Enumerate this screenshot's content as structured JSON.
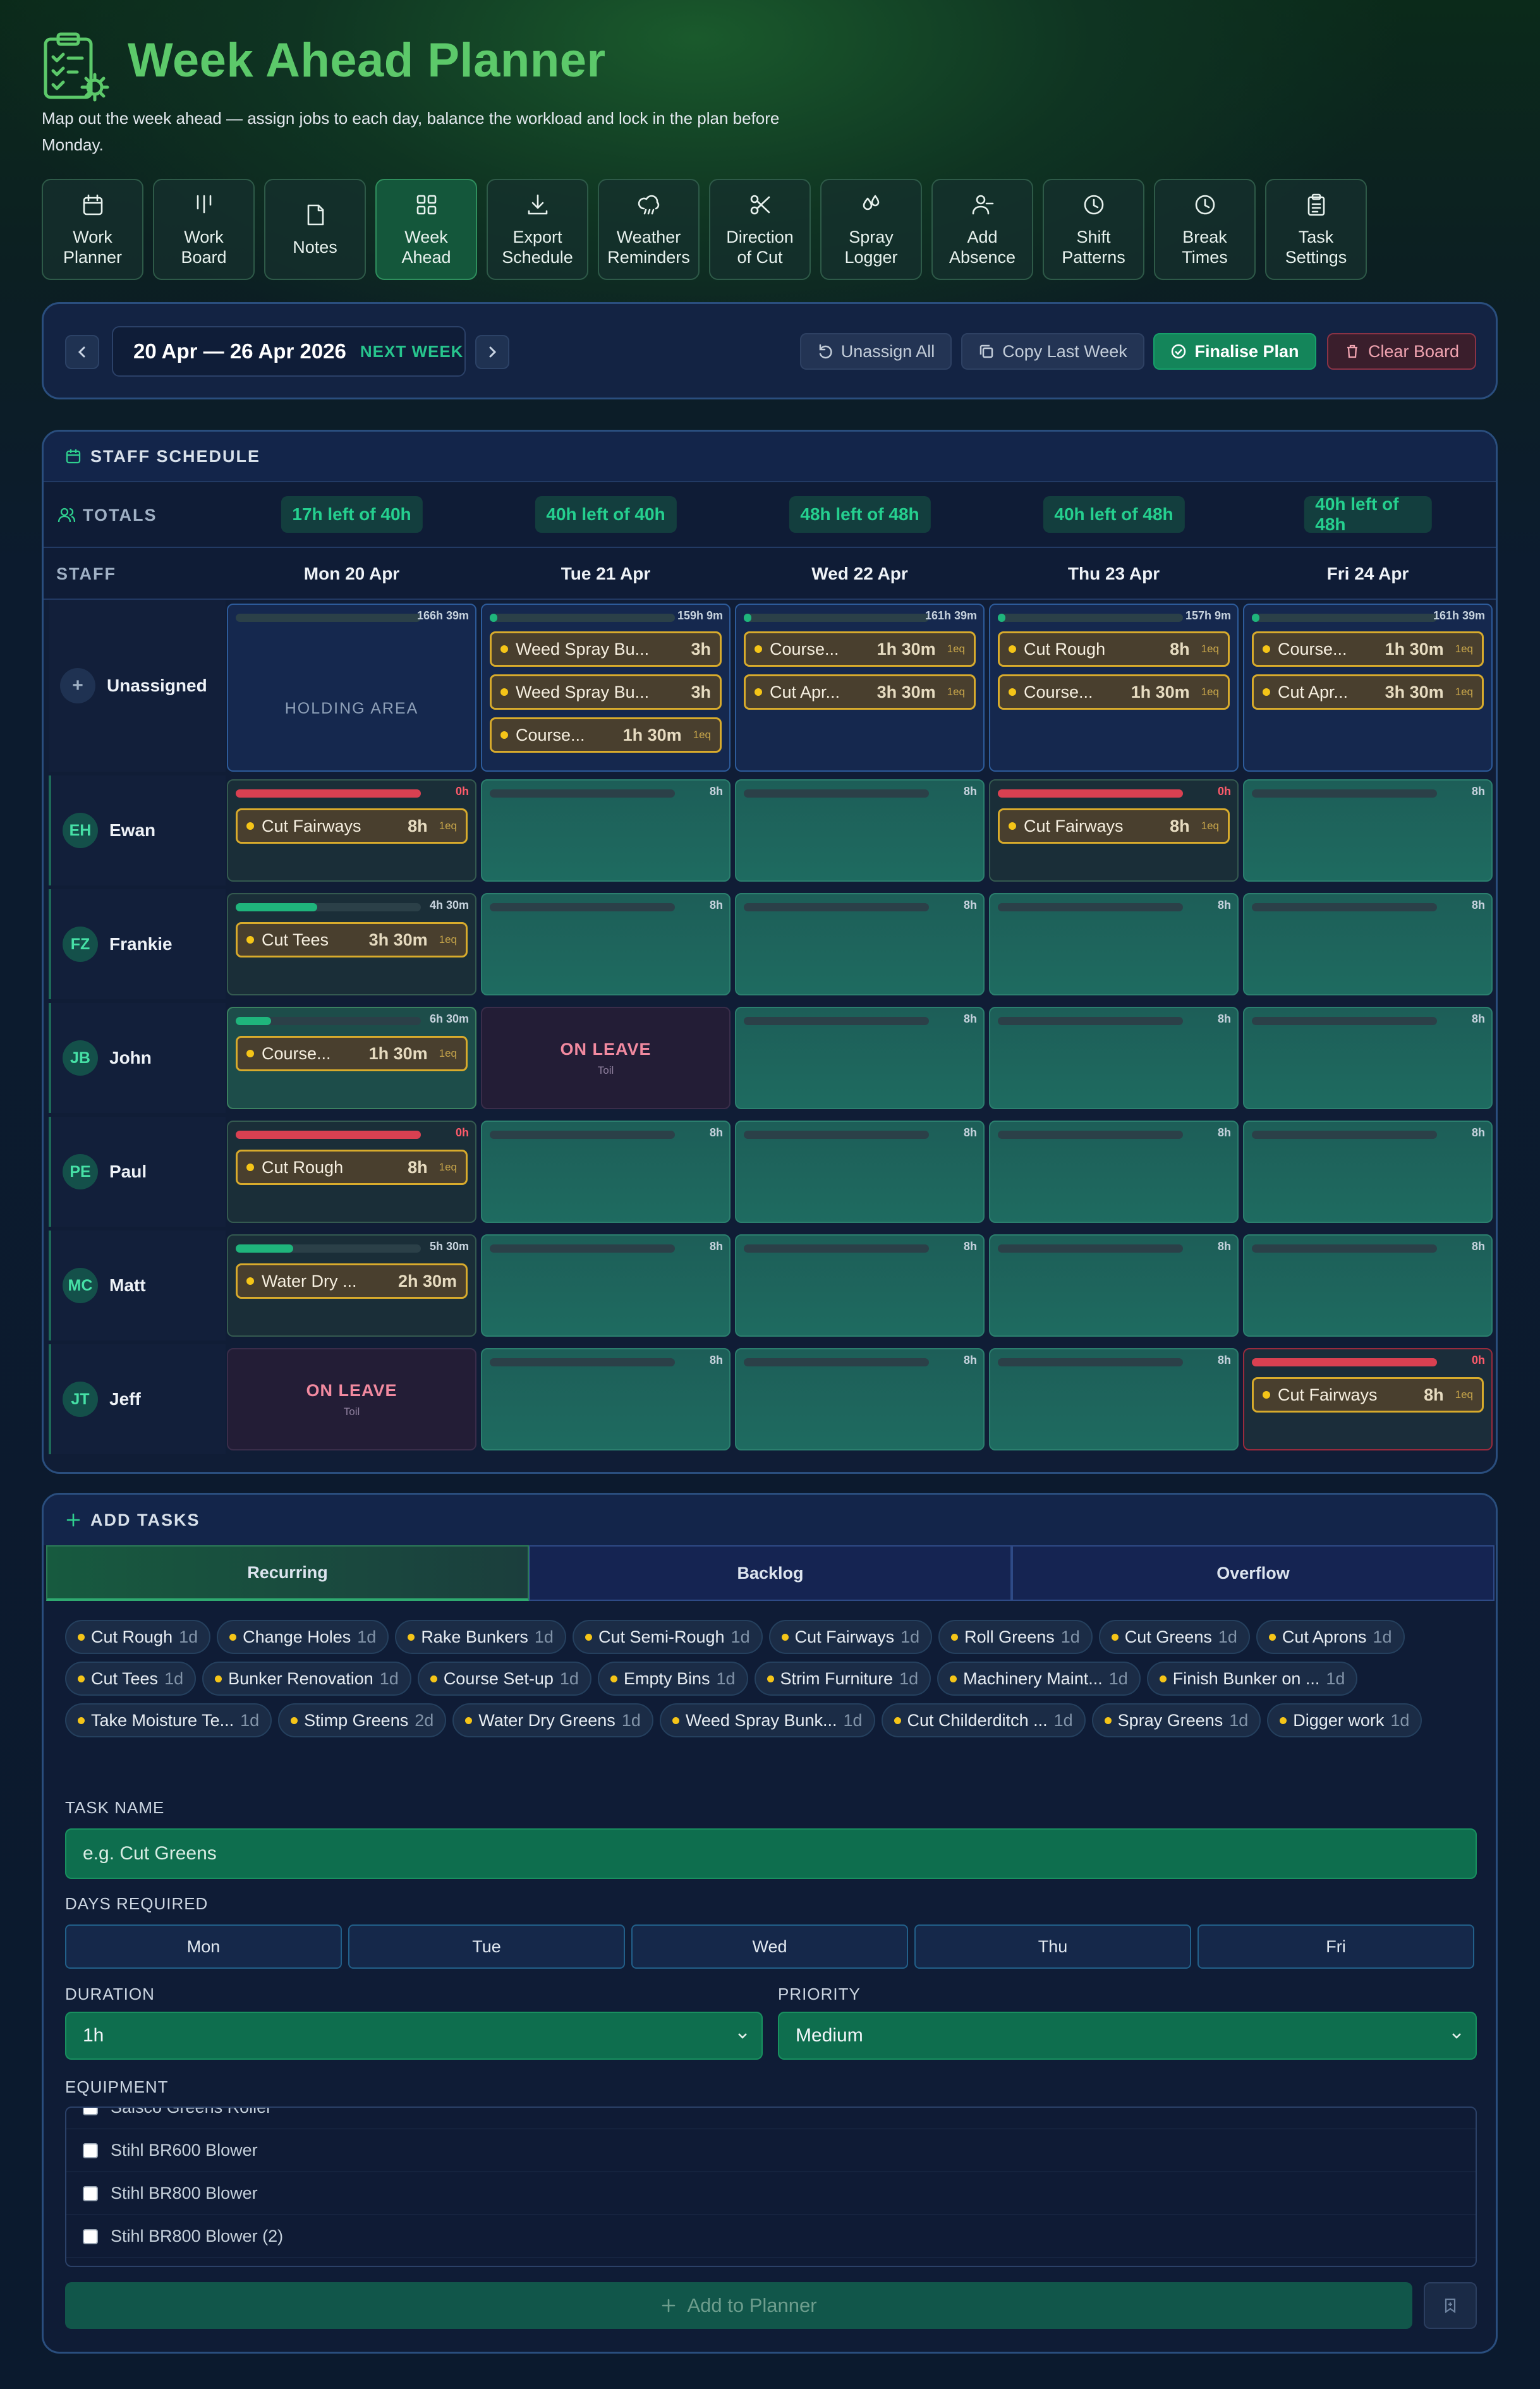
{
  "app": {
    "title": "Week Ahead Planner",
    "subtitle": "Map out the week ahead — assign jobs to each day, balance the workload and lock in the plan before Monday.",
    "icon": "clipboard-gear-icon",
    "accent": "#5cc96a"
  },
  "nav": [
    {
      "label": "Work\nPlanner",
      "icon": "calendar-icon"
    },
    {
      "label": "Work\nBoard",
      "icon": "columns-icon"
    },
    {
      "label": "Notes",
      "icon": "note-icon"
    },
    {
      "label": "Week\nAhead",
      "icon": "grid-icon",
      "active": true
    },
    {
      "label": "Export\nSchedule",
      "icon": "download-icon"
    },
    {
      "label": "Weather\nReminders",
      "icon": "cloud-rain-icon"
    },
    {
      "label": "Direction\nof Cut",
      "icon": "scissors-icon"
    },
    {
      "label": "Spray\nLogger",
      "icon": "droplets-icon"
    },
    {
      "label": "Add\nAbsence",
      "icon": "user-minus-icon"
    },
    {
      "label": "Shift\nPatterns",
      "icon": "clock-icon"
    },
    {
      "label": "Break\nTimes",
      "icon": "clock-icon"
    },
    {
      "label": "Task\nSettings",
      "icon": "clipboard-icon"
    }
  ],
  "week": {
    "range": "20 Apr — 26 Apr 2026",
    "tag": "NEXT WEEK",
    "unassign_all": "Unassign All",
    "copy_last_week": "Copy Last Week",
    "finalise": "Finalise Plan",
    "clear": "Clear Board"
  },
  "schedule": {
    "heading": "STAFF SCHEDULE",
    "totals_label": "TOTALS",
    "staff_label": "STAFF",
    "totals": [
      "17h left of 40h",
      "40h left of 40h",
      "48h left of 48h",
      "40h left of 48h",
      "40h left of 48h"
    ],
    "days": [
      "Mon  20 Apr",
      "Tue  21 Apr",
      "Wed  22 Apr",
      "Thu  23 Apr",
      "Fri  24 Apr"
    ],
    "unassigned": {
      "label": "Unassigned",
      "holding": "HOLDING AREA",
      "times": [
        "166h 39m",
        "159h 9m",
        "161h 39m",
        "157h 9m",
        "161h 39m"
      ],
      "fill": [
        0,
        0.04,
        0.04,
        0.04,
        0.04
      ],
      "tasks": [
        [],
        [
          {
            "name": "Weed Spray Bu...",
            "dur": "3h",
            "eq": ""
          },
          {
            "name": "Weed Spray Bu...",
            "dur": "3h",
            "eq": ""
          },
          {
            "name": "Course...",
            "dur": "1h 30m",
            "eq": "1eq"
          }
        ],
        [
          {
            "name": "Course...",
            "dur": "1h 30m",
            "eq": "1eq"
          },
          {
            "name": "Cut Apr...",
            "dur": "3h 30m",
            "eq": "1eq"
          }
        ],
        [
          {
            "name": "Cut Rough",
            "dur": "8h",
            "eq": "1eq"
          },
          {
            "name": "Course...",
            "dur": "1h 30m",
            "eq": "1eq"
          }
        ],
        [
          {
            "name": "Course...",
            "dur": "1h 30m",
            "eq": "1eq"
          },
          {
            "name": "Cut Apr...",
            "dur": "3h 30m",
            "eq": "1eq"
          }
        ]
      ]
    },
    "leave_title": "ON LEAVE",
    "leave_sub": "Toil",
    "staff": [
      {
        "initials": "EH",
        "name": "Ewan",
        "days": [
          {
            "time": "0h",
            "fill": 1,
            "status": "over",
            "task": {
              "name": "Cut Fairways",
              "dur": "8h",
              "eq": "1eq"
            }
          },
          {
            "time": "8h",
            "fill": 0
          },
          {
            "time": "8h",
            "fill": 0
          },
          {
            "time": "0h",
            "fill": 1,
            "status": "over",
            "task": {
              "name": "Cut Fairways",
              "dur": "8h",
              "eq": "1eq"
            }
          },
          {
            "time": "8h",
            "fill": 0
          }
        ]
      },
      {
        "initials": "FZ",
        "name": "Frankie",
        "days": [
          {
            "time": "4h 30m",
            "fill": 0.44,
            "task": {
              "name": "Cut Tees",
              "dur": "3h 30m",
              "eq": "1eq"
            }
          },
          {
            "time": "8h",
            "fill": 0
          },
          {
            "time": "8h",
            "fill": 0
          },
          {
            "time": "8h",
            "fill": 0
          },
          {
            "time": "8h",
            "fill": 0
          }
        ]
      },
      {
        "initials": "JB",
        "name": "John",
        "days": [
          {
            "time": "6h 30m",
            "fill": 0.19,
            "mixed": true,
            "task": {
              "name": "Course...",
              "dur": "1h 30m",
              "eq": "1eq"
            }
          },
          {
            "leave": true
          },
          {
            "time": "8h",
            "fill": 0
          },
          {
            "time": "8h",
            "fill": 0
          },
          {
            "time": "8h",
            "fill": 0
          }
        ]
      },
      {
        "initials": "PE",
        "name": "Paul",
        "days": [
          {
            "time": "0h",
            "fill": 1,
            "status": "over",
            "task": {
              "name": "Cut Rough",
              "dur": "8h",
              "eq": "1eq"
            }
          },
          {
            "time": "8h",
            "fill": 0
          },
          {
            "time": "8h",
            "fill": 0
          },
          {
            "time": "8h",
            "fill": 0
          },
          {
            "time": "8h",
            "fill": 0
          }
        ]
      },
      {
        "initials": "MC",
        "name": "Matt",
        "days": [
          {
            "time": "5h 30m",
            "fill": 0.31,
            "task": {
              "name": "Water Dry ...",
              "dur": "2h 30m",
              "eq": ""
            }
          },
          {
            "time": "8h",
            "fill": 0
          },
          {
            "time": "8h",
            "fill": 0
          },
          {
            "time": "8h",
            "fill": 0
          },
          {
            "time": "8h",
            "fill": 0
          }
        ]
      },
      {
        "initials": "JT",
        "name": "Jeff",
        "days": [
          {
            "leave": true
          },
          {
            "time": "8h",
            "fill": 0
          },
          {
            "time": "8h",
            "fill": 0
          },
          {
            "time": "8h",
            "fill": 0
          },
          {
            "time": "0h",
            "fill": 1,
            "status": "over",
            "task": {
              "name": "Cut Fairways",
              "dur": "8h",
              "eq": "1eq"
            }
          }
        ]
      }
    ]
  },
  "add_tasks": {
    "heading": "ADD TASKS",
    "tabs": [
      "Recurring",
      "Backlog",
      "Overflow"
    ],
    "active_tab": "Recurring",
    "chips": [
      {
        "name": "Cut Rough",
        "d": "1d"
      },
      {
        "name": "Change Holes",
        "d": "1d"
      },
      {
        "name": "Rake Bunkers",
        "d": "1d"
      },
      {
        "name": "Cut Semi-Rough",
        "d": "1d"
      },
      {
        "name": "Cut Fairways",
        "d": "1d"
      },
      {
        "name": "Roll Greens",
        "d": "1d"
      },
      {
        "name": "Cut Greens",
        "d": "1d"
      },
      {
        "name": "Cut Aprons",
        "d": "1d"
      },
      {
        "name": "Cut Tees",
        "d": "1d"
      },
      {
        "name": "Bunker Renovation",
        "d": "1d"
      },
      {
        "name": "Course Set-up",
        "d": "1d"
      },
      {
        "name": "Empty Bins",
        "d": "1d"
      },
      {
        "name": "Strim Furniture",
        "d": "1d"
      },
      {
        "name": "Machinery Maint...",
        "d": "1d"
      },
      {
        "name": "Finish Bunker on ...",
        "d": "1d"
      },
      {
        "name": "Take Moisture Te...",
        "d": "1d"
      },
      {
        "name": "Stimp Greens",
        "d": "2d"
      },
      {
        "name": "Water Dry Greens",
        "d": "1d"
      },
      {
        "name": "Weed Spray Bunk...",
        "d": "1d"
      },
      {
        "name": "Cut Childerditch ...",
        "d": "1d"
      },
      {
        "name": "Spray Greens",
        "d": "1d"
      },
      {
        "name": "Digger work",
        "d": "1d"
      }
    ],
    "task_name_label": "TASK NAME",
    "task_name_placeholder": "e.g. Cut Greens",
    "days_label": "DAYS REQUIRED",
    "days": [
      "Mon",
      "Tue",
      "Wed",
      "Thu",
      "Fri"
    ],
    "duration_label": "DURATION",
    "duration_value": "1h",
    "priority_label": "PRIORITY",
    "priority_value": "Medium",
    "equipment_label": "EQUIPMENT",
    "equipment": [
      "Salsco Greens Roller",
      "Stihl BR600 Blower",
      "Stihl BR800 Blower",
      "Stihl BR800 Blower (2)"
    ],
    "add_button": "Add to Planner"
  }
}
